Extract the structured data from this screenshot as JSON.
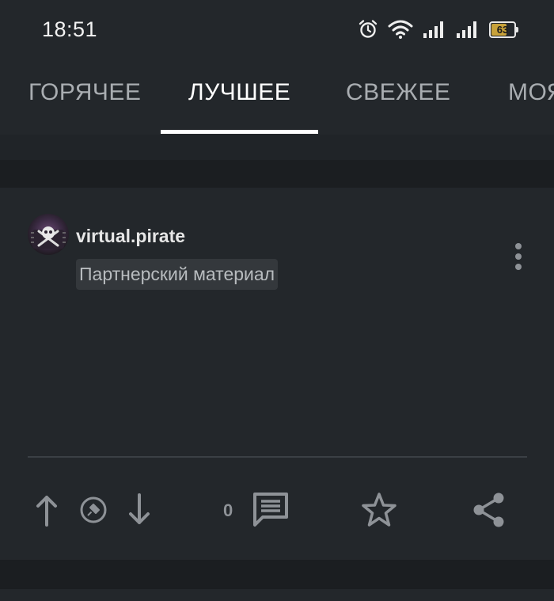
{
  "status_bar": {
    "time": "18:51",
    "battery_level": "63",
    "icons": [
      "alarm-icon",
      "wifi-icon",
      "signal-icon",
      "signal-icon",
      "battery-icon"
    ]
  },
  "tabs": [
    {
      "label": "ГОРЯЧЕЕ",
      "active": false
    },
    {
      "label": "ЛУЧШЕЕ",
      "active": true
    },
    {
      "label": "СВЕЖЕЕ",
      "active": false
    },
    {
      "label": "МОЯ ЛЕНТА",
      "active": false
    }
  ],
  "post": {
    "author": "virtual.pirate",
    "badge": "Партнерский материал",
    "comments_count": "0",
    "actions": [
      "upvote-icon",
      "save-post-icon",
      "downvote-icon",
      "comment-icon",
      "star-icon",
      "share-icon"
    ]
  },
  "colors": {
    "background": "#1b1e21",
    "surface": "#23272b",
    "text_primary": "#e6e6e6",
    "icon": "#8e9297"
  }
}
